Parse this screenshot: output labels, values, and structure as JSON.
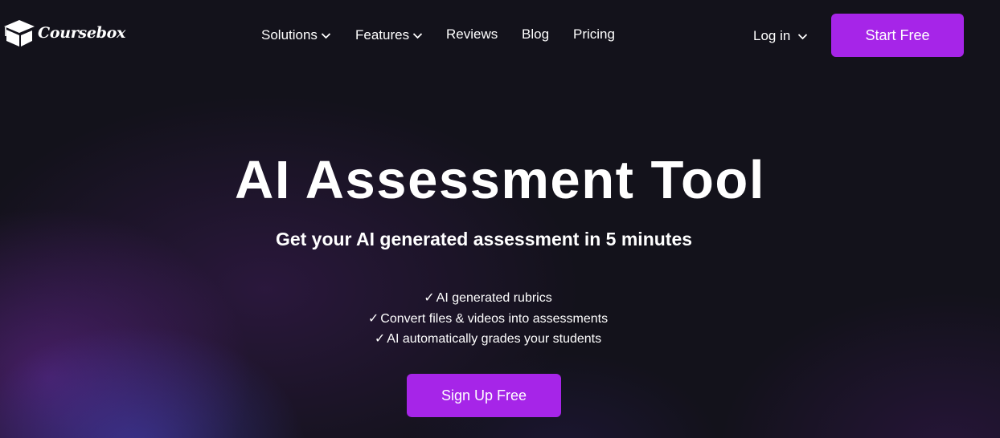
{
  "brand": {
    "name": "Coursebox",
    "logo_icon": "graduation-cap-box-icon"
  },
  "nav": {
    "items": [
      {
        "label": "Solutions",
        "has_dropdown": true
      },
      {
        "label": "Features",
        "has_dropdown": true
      },
      {
        "label": "Reviews",
        "has_dropdown": false
      },
      {
        "label": "Blog",
        "has_dropdown": false
      },
      {
        "label": "Pricing",
        "has_dropdown": false
      }
    ],
    "login_label": "Log in",
    "start_button_label": "Start Free"
  },
  "hero": {
    "title": "AI Assessment Tool",
    "subtitle": "Get your AI generated assessment in 5 minutes",
    "check_glyph": "✓",
    "features": [
      "AI generated rubrics",
      "Convert files & videos into assessments",
      "AI automatically grades your students"
    ],
    "cta_label": "Sign Up Free"
  },
  "colors": {
    "background": "#13121b",
    "accent": "#a625e8",
    "text": "#ffffff"
  }
}
